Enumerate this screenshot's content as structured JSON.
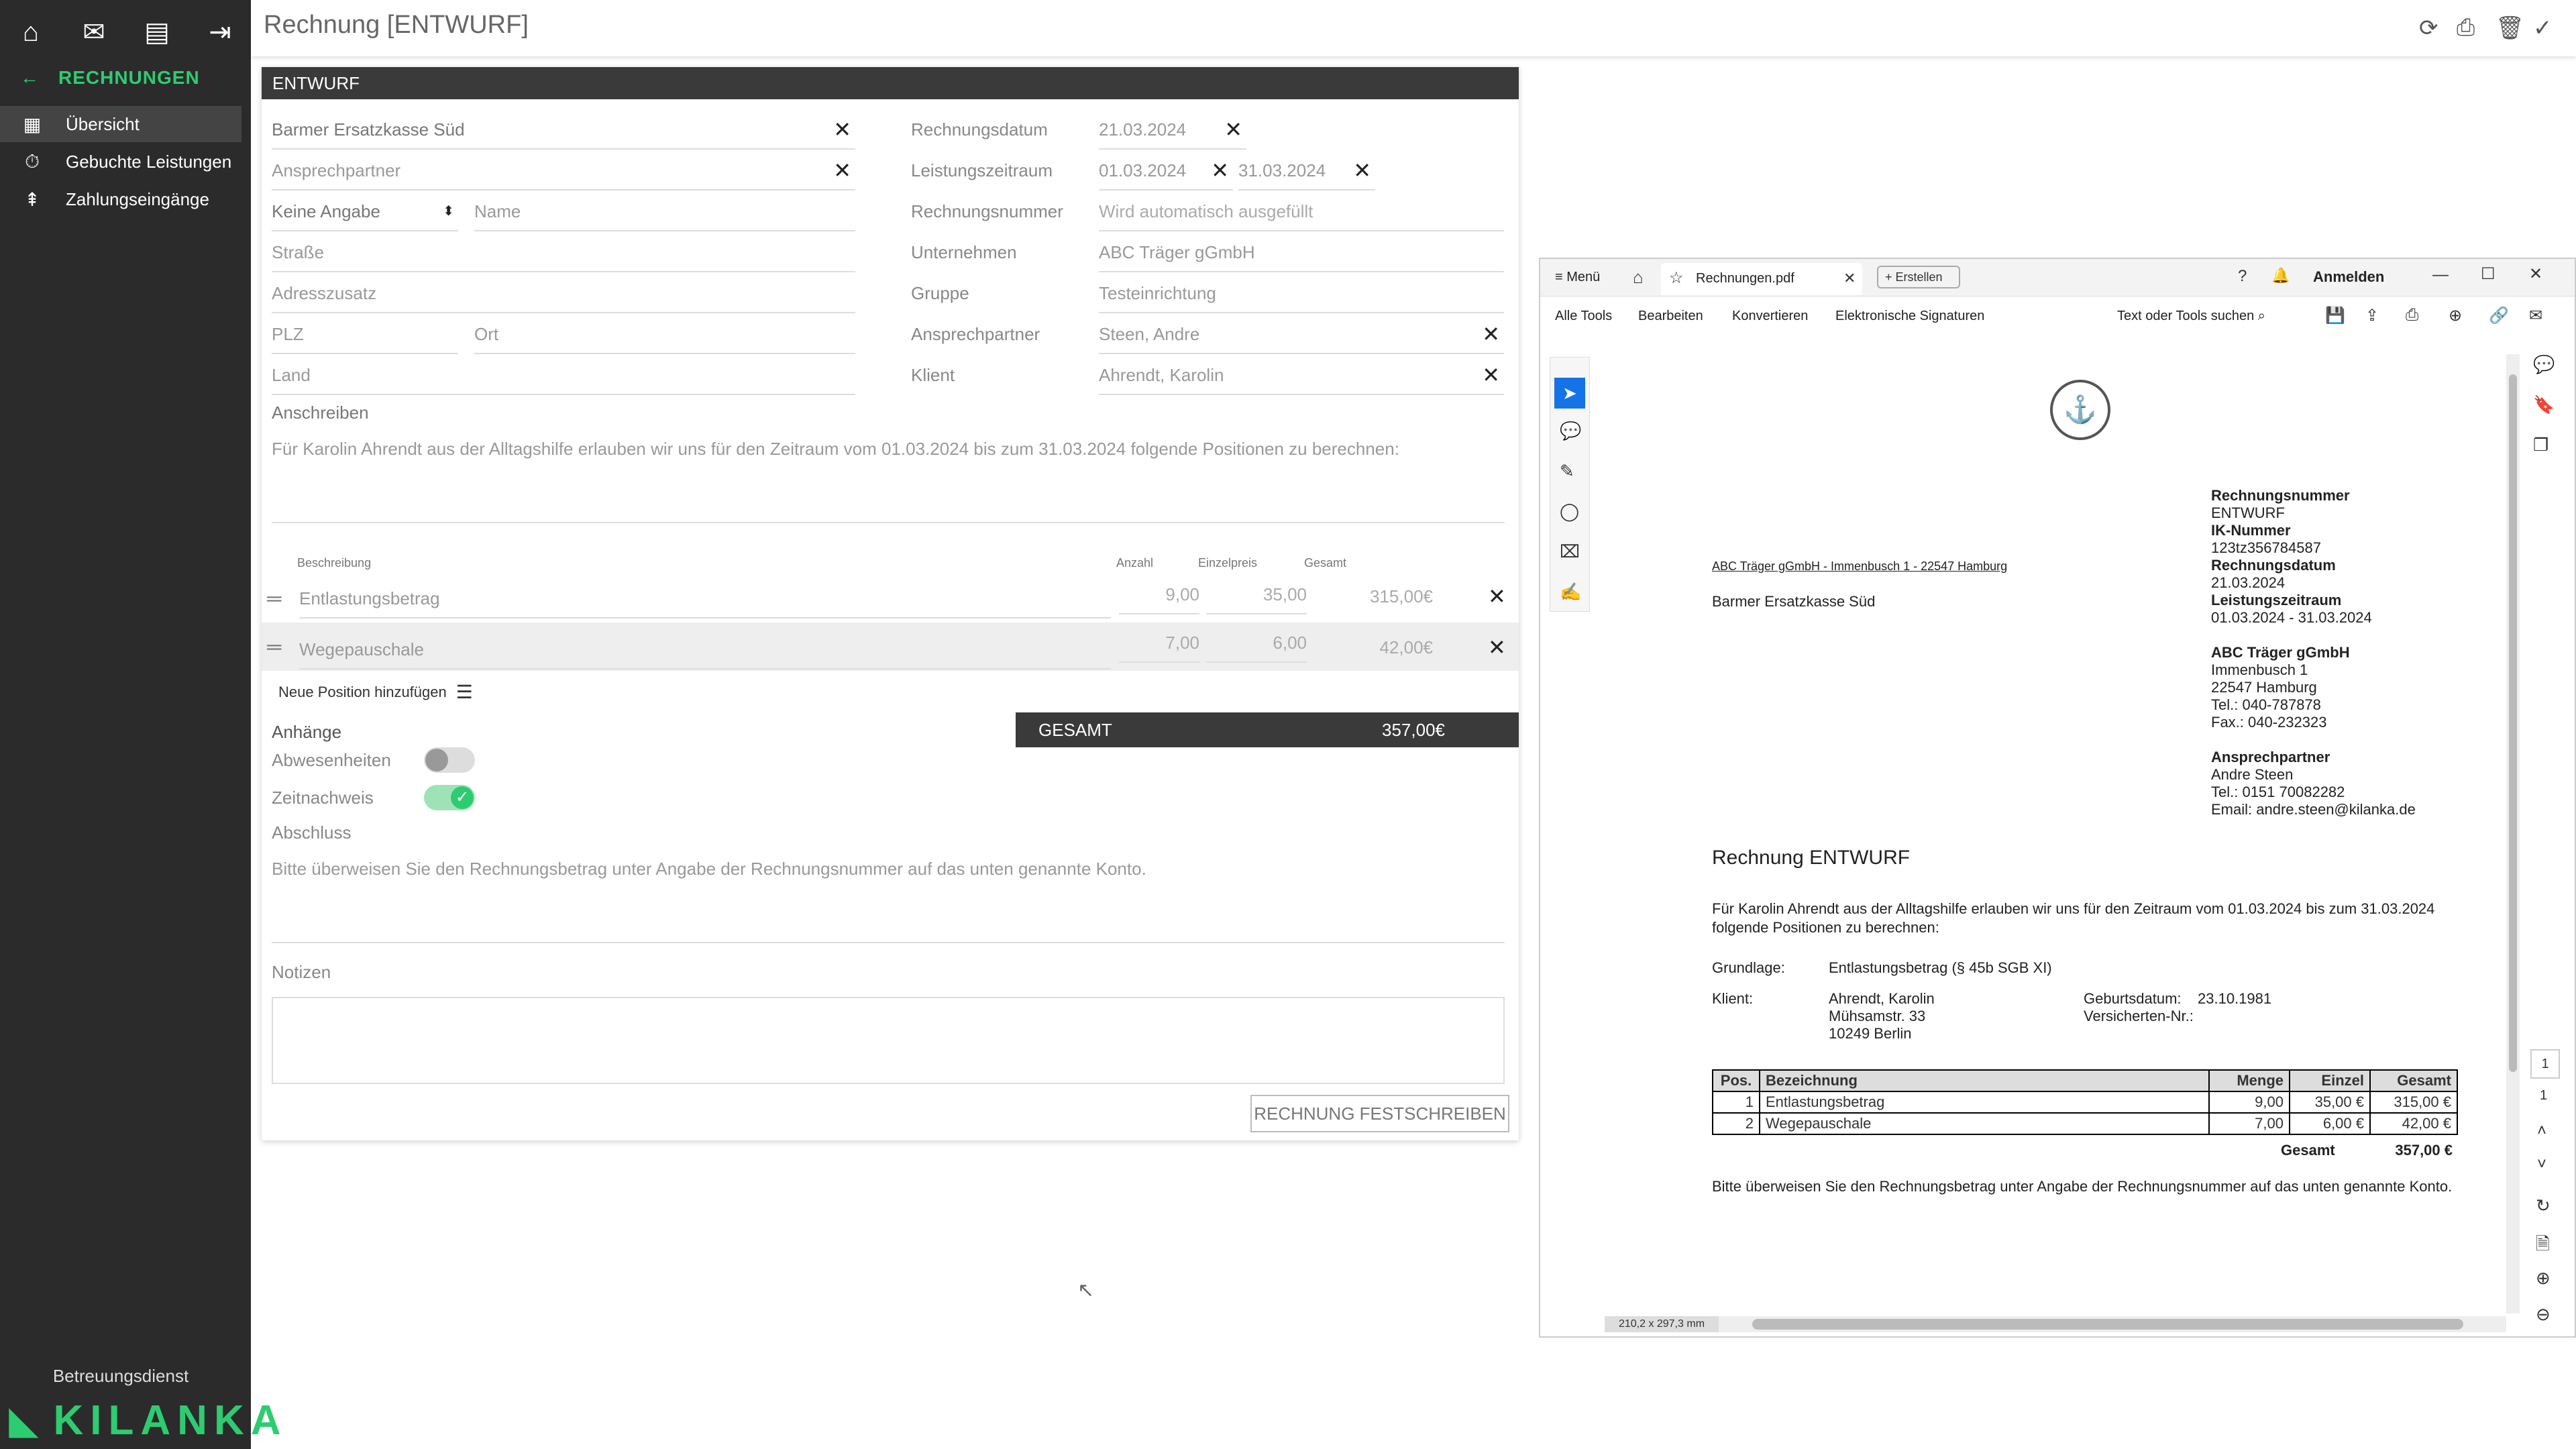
{
  "sidebar": {
    "back_label": "RECHNUNGEN",
    "items": [
      {
        "label": "Übersicht",
        "icon": "clipboard-icon"
      },
      {
        "label": "Gebuchte Leistungen",
        "icon": "stopwatch-icon"
      },
      {
        "label": "Zahlungseingänge",
        "icon": "payment-icon"
      }
    ],
    "footer_label": "Betreuungsdienst",
    "logo_text": "KILANKA"
  },
  "header": {
    "title": "Rechnung [ENTWURF]"
  },
  "form": {
    "section_title": "ENTWURF",
    "recipient": "Barmer Ersatzkasse Süd",
    "contact_placeholder": "Ansprechpartner",
    "salutation": "Keine Angabe",
    "name_placeholder": "Name",
    "street_placeholder": "Straße",
    "address_extra_placeholder": "Adresszusatz",
    "zip_placeholder": "PLZ",
    "city_placeholder": "Ort",
    "country_placeholder": "Land",
    "letter_label": "Anschreiben",
    "letter_text": "Für Karolin Ahrendt aus der Alltagshilfe erlauben wir uns für den Zeitraum vom 01.03.2024 bis zum 31.03.2024 folgende Positionen zu berechnen:",
    "right": {
      "invoice_date_label": "Rechnungsdatum",
      "invoice_date": "21.03.2024",
      "period_label": "Leistungszeitraum",
      "period_from": "01.03.2024",
      "period_to": "31.03.2024",
      "invoice_no_label": "Rechnungsnummer",
      "invoice_no_placeholder": "Wird automatisch ausgefüllt",
      "company_label": "Unternehmen",
      "company": "ABC Träger gGmbH",
      "group_label": "Gruppe",
      "group": "Testeinrichtung",
      "contact_label": "Ansprechpartner",
      "contact": "Steen, Andre",
      "client_label": "Klient",
      "client": "Ahrendt, Karolin"
    },
    "table": {
      "headers": [
        "Beschreibung",
        "Anzahl",
        "Einzelpreis",
        "Gesamt"
      ],
      "rows": [
        {
          "desc": "Entlastungsbetrag",
          "qty": "9,00",
          "price": "35,00",
          "total": "315,00€"
        },
        {
          "desc": "Wegepauschale",
          "qty": "7,00",
          "price": "6,00",
          "total": "42,00€"
        }
      ],
      "add_label": "Neue Position hinzufügen"
    },
    "total_label": "GESAMT",
    "total_value": "357,00€",
    "attachments_label": "Anhänge",
    "absences_label": "Abwesenheiten",
    "time_label": "Zeitnachweis",
    "closing_label": "Abschluss",
    "closing_text": "Bitte überweisen Sie den Rechnungsbetrag unter Angabe der Rechnungsnummer auf das unten genannte Konto.",
    "notes_label": "Notizen",
    "submit_label": "RECHNUNG FESTSCHREIBEN"
  },
  "pdf": {
    "menu_label": "Menü",
    "tab_label": "Rechnungen.pdf",
    "create_label": "Erstellen",
    "signin_label": "Anmelden",
    "toolbar": [
      "Alle Tools",
      "Bearbeiten",
      "Konvertieren",
      "Elektronische Signaturen"
    ],
    "search_label": "Text oder Tools suchen",
    "sender_line": "ABC Träger gGmbH - Immenbusch 1 - 22547 Hamburg",
    "recipient": "Barmer Ersatzkasse Süd",
    "info": [
      {
        "k": "Rechnungsnummer",
        "v": "ENTWURF"
      },
      {
        "k": "IK-Nummer",
        "v": "123tz356784587"
      },
      {
        "k": "Rechnungsdatum",
        "v": "21.03.2024"
      },
      {
        "k": "Leistungszeitraum",
        "v": "01.03.2024 - 31.03.2024"
      }
    ],
    "company_block": [
      "ABC Träger gGmbH",
      "Immenbusch 1",
      "22547 Hamburg",
      "Tel.: 040-787878",
      "Fax.: 040-232323"
    ],
    "contact_block": [
      "Ansprechpartner",
      "Andre Steen",
      "Tel.: 0151 70082282",
      "Email: andre.steen@kilanka.de"
    ],
    "title": "Rechnung ENTWURF",
    "intro1": "Für Karolin Ahrendt aus der Alltagshilfe erlauben wir uns für den Zeitraum vom 01.03.2024 bis zum 31.03.2024",
    "intro2": "folgende Positionen zu berechnen:",
    "basis_label": "Grundlage:",
    "basis_value": "Entlastungsbetrag (§ 45b SGB XI)",
    "client_label": "Klient:",
    "client_lines": [
      "Ahrendt, Karolin",
      "Mühsamstr. 33",
      "10249 Berlin"
    ],
    "birth_label": "Geburtsdatum:",
    "birth_value": "23.10.1981",
    "insured_label": "Versicherten-Nr.:",
    "table_headers": [
      "Pos.",
      "Bezeichnung",
      "Menge",
      "Einzel",
      "Gesamt"
    ],
    "table_rows": [
      [
        "1",
        "Entlastungsbetrag",
        "9,00",
        "35,00 €",
        "315,00 €"
      ],
      [
        "2",
        "Wegepauschale",
        "7,00",
        "6,00 €",
        "42,00 €"
      ]
    ],
    "sum_label": "Gesamt",
    "sum_value": "357,00 €",
    "closing": "Bitte überweisen Sie den Rechnungsbetrag unter Angabe der Rechnungsnummer auf das unten genannte Konto.",
    "page_size": "210,2 x 297,3 mm",
    "page_current": "1",
    "page_total": "1"
  }
}
